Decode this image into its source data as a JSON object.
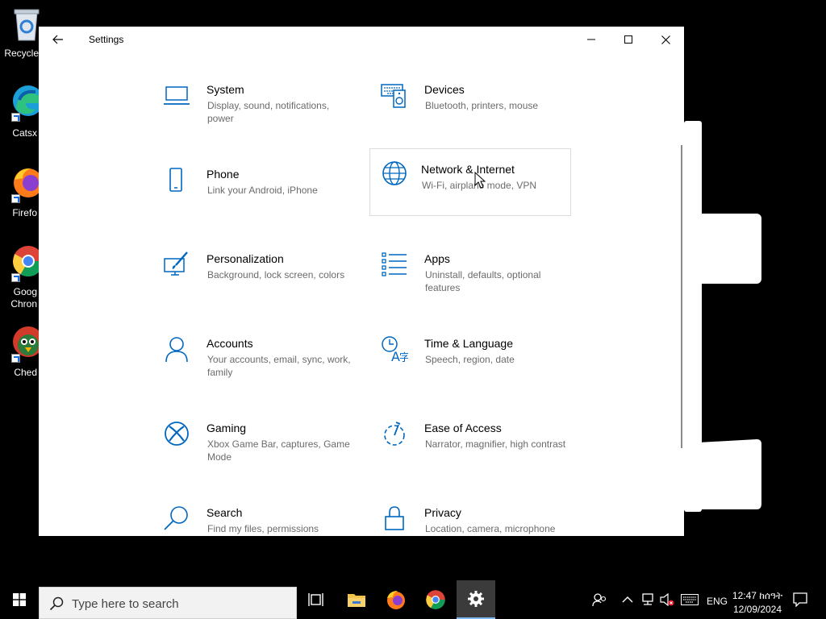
{
  "desktop": {
    "icons": [
      {
        "label": "Recycle",
        "icon": "recycle-bin-icon"
      },
      {
        "label": "Catsx",
        "icon": "edge-icon"
      },
      {
        "label": "Firefo",
        "icon": "firefox-icon"
      },
      {
        "label": "Goog",
        "label2": "Chron",
        "icon": "chrome-icon"
      },
      {
        "label": "Ched",
        "icon": "cheddar-bird-icon"
      }
    ]
  },
  "window": {
    "title": "Settings",
    "back_icon": "back-arrow-icon",
    "accent": "#0067c0"
  },
  "categories": [
    {
      "title": "System",
      "desc": "Display, sound, notifications, power",
      "icon": "laptop-icon"
    },
    {
      "title": "Devices",
      "desc": "Bluetooth, printers, mouse",
      "icon": "keyboard-speaker-icon"
    },
    {
      "title": "Phone",
      "desc": "Link your Android, iPhone",
      "icon": "phone-icon"
    },
    {
      "title": "Network & Internet",
      "desc": "Wi-Fi, airplane mode, VPN",
      "icon": "globe-icon"
    },
    {
      "title": "Personalization",
      "desc": "Background, lock screen, colors",
      "icon": "paint-brush-icon"
    },
    {
      "title": "Apps",
      "desc": "Uninstall, defaults, optional features",
      "icon": "apps-list-icon"
    },
    {
      "title": "Accounts",
      "desc": "Your accounts, email, sync, work, family",
      "icon": "person-icon"
    },
    {
      "title": "Time & Language",
      "desc": "Speech, region, date",
      "icon": "time-language-icon"
    },
    {
      "title": "Gaming",
      "desc": "Xbox Game Bar, captures, Game Mode",
      "icon": "xbox-icon"
    },
    {
      "title": "Ease of Access",
      "desc": "Narrator, magnifier, high contrast",
      "icon": "ease-of-access-icon"
    },
    {
      "title": "Search",
      "desc": "Find my files, permissions",
      "icon": "search-icon"
    },
    {
      "title": "Privacy",
      "desc": "Location, camera, microphone",
      "icon": "lock-icon"
    }
  ],
  "taskbar": {
    "search_placeholder": "Type here to search",
    "lang": "ENG",
    "time": "12:47 ከሰዓት",
    "date": "12/09/2024"
  }
}
